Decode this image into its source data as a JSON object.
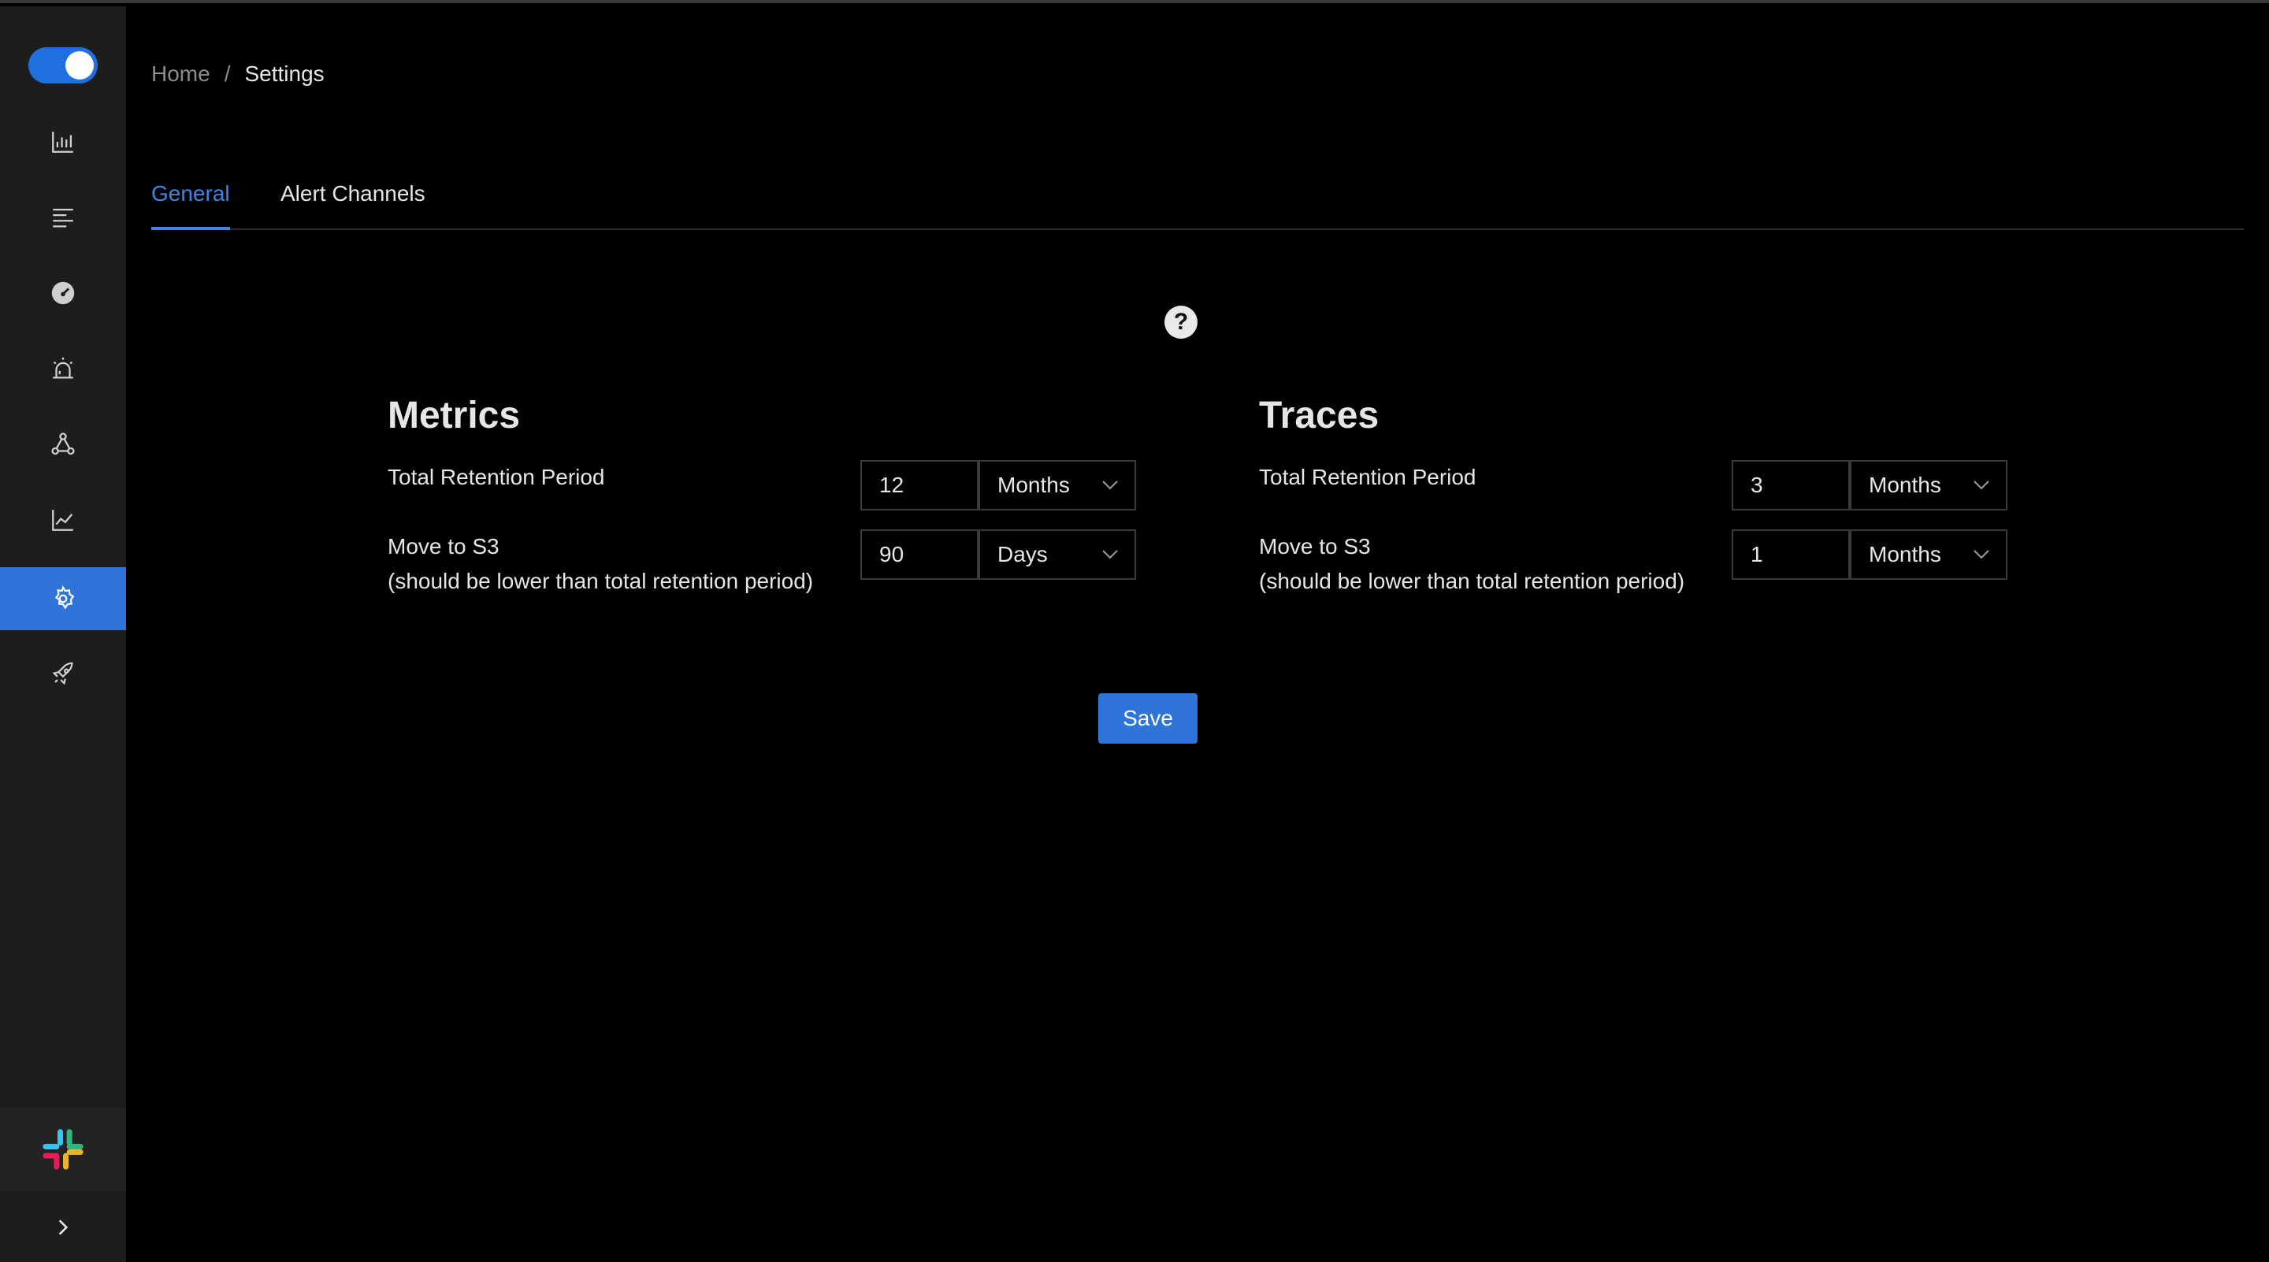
{
  "breadcrumb": {
    "home": "Home",
    "separator": "/",
    "current": "Settings"
  },
  "tabs": [
    {
      "label": "General",
      "active": true
    },
    {
      "label": "Alert Channels",
      "active": false
    }
  ],
  "sidebar": {
    "items": [
      {
        "name": "metrics-icon"
      },
      {
        "name": "list-icon"
      },
      {
        "name": "dashboard-gauge-icon"
      },
      {
        "name": "alarm-icon"
      },
      {
        "name": "service-map-icon"
      },
      {
        "name": "line-chart-icon"
      },
      {
        "name": "settings-icon",
        "active": true
      },
      {
        "name": "rocket-icon"
      }
    ],
    "slack": "slack-icon",
    "collapse": "chevron-right-icon"
  },
  "help": {
    "symbol": "?"
  },
  "metrics": {
    "title": "Metrics",
    "retention_label": "Total Retention Period",
    "retention_value": "12",
    "retention_unit": "Months",
    "s3_label_line1": "Move to S3",
    "s3_label_line2": "(should be lower than total retention period)",
    "s3_value": "90",
    "s3_unit": "Days"
  },
  "traces": {
    "title": "Traces",
    "retention_label": "Total Retention Period",
    "retention_value": "3",
    "retention_unit": "Months",
    "s3_label_line1": "Move to S3",
    "s3_label_line2": "(should be lower than total retention period)",
    "s3_value": "1",
    "s3_unit": "Months"
  },
  "save_label": "Save",
  "colors": {
    "accent": "#2f74d9",
    "background": "#000000",
    "sidebar": "#1d1d1d"
  }
}
